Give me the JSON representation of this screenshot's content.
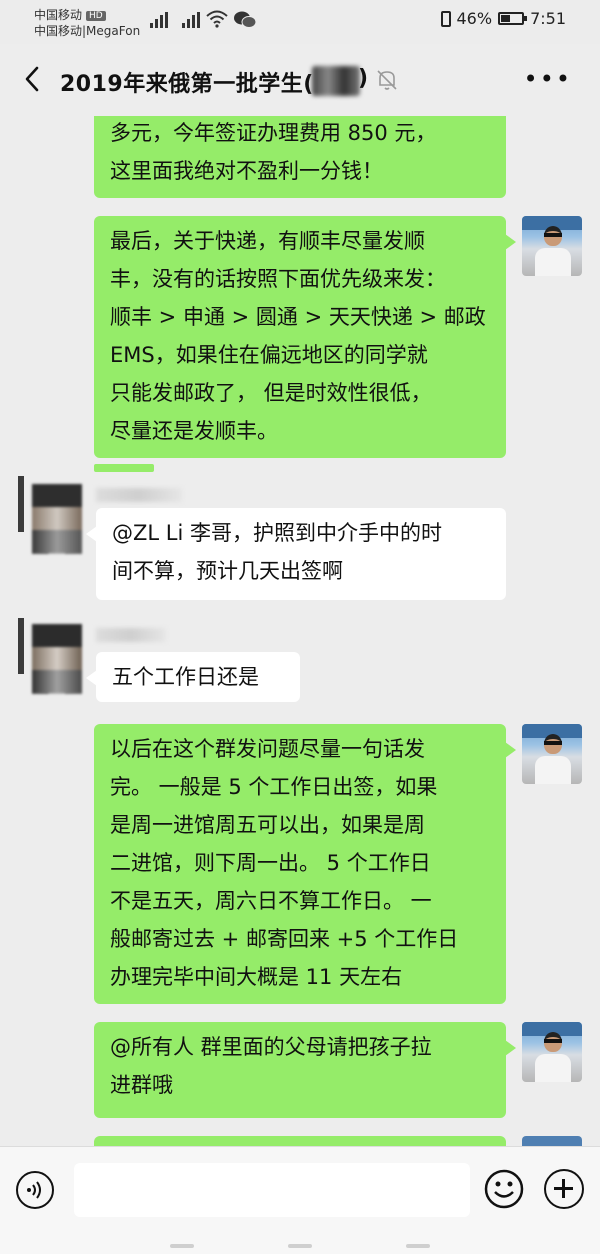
{
  "status_bar": {
    "carrier_line1": "中国移动",
    "carrier_hd": "HD",
    "carrier_line2": "中国移动|MegaFon",
    "battery_percent_text": "46%",
    "battery_level": 0.46,
    "time": "7:51",
    "icons": [
      "signal-icon",
      "wifi-icon",
      "wechat-icon",
      "vibrate-icon",
      "battery-icon"
    ]
  },
  "header": {
    "title": "2019年来俄第一批学生(",
    "title_tail": ")",
    "icons": [
      "back-arrow-icon",
      "mute-bell-icon",
      "more-dots-icon"
    ]
  },
  "messages": [
    {
      "sender": "me",
      "lines": [
        "多元，今年签证办理费用 850 元，",
        "这里面我绝对不盈利一分钱！"
      ]
    },
    {
      "sender": "me",
      "lines": [
        "最后，关于快递，有顺丰尽量发顺",
        "丰，没有的话按照下面优先级来发：",
        "顺丰 > 申通 > 圆通 > 天天快递 > 邮政",
        "EMS，如果住在偏远地区的同学就",
        "只能发邮政了， 但是时效性很低，",
        "尽量还是发顺丰。"
      ]
    },
    {
      "sender": "other",
      "lines": [
        "@ZL Li  李哥，护照到中介手中的时",
        "间不算，预计几天出签啊"
      ]
    },
    {
      "sender": "other",
      "lines": [
        "五个工作日还是"
      ]
    },
    {
      "sender": "me",
      "lines": [
        "以后在这个群发问题尽量一句话发",
        "完。 一般是 5 个工作日出签，如果",
        "是周一进馆周五可以出，如果是周",
        "二进馆，则下周一出。 5 个工作日",
        "不是五天，周六日不算工作日。 一",
        "般邮寄过去 + 邮寄回来 +5 个工作日",
        "办理完毕中间大概是 11 天左右"
      ]
    },
    {
      "sender": "me",
      "lines": [
        "@所有人  群里面的父母请把孩子拉",
        "进群哦"
      ]
    }
  ],
  "input_bar": {
    "text_value": "",
    "icons": [
      "voice-icon",
      "emoji-icon",
      "plus-icon"
    ]
  }
}
